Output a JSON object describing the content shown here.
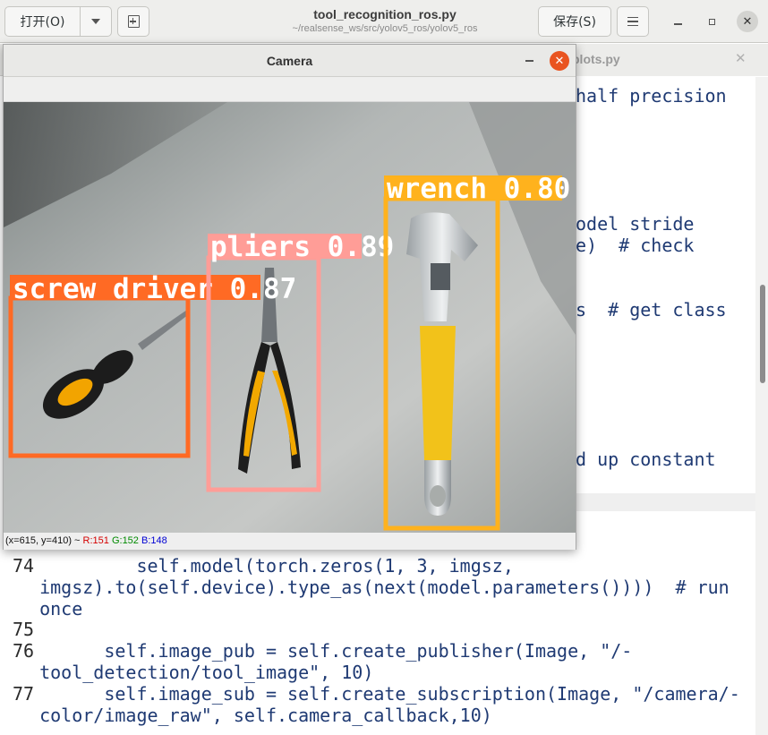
{
  "header": {
    "open_label": "打开(O)",
    "save_label": "保存(S)",
    "title": "tool_recognition_ros.py",
    "subtitle": "~/realsense_ws/src/yolov5_ros/yolov5_ros"
  },
  "tabs": [
    {
      "label": "plots.py"
    }
  ],
  "editor": {
    "top_fragments": [
      "half precision",
      "odel stride",
      "e)  # check",
      "s  # get class",
      "d up constant"
    ],
    "lines": [
      {
        "no": "74",
        "text": "           self.model(torch.zeros(1, 3, imgsz,"
      },
      {
        "no": "",
        "text": "  imgsz).to(self.device).type_as(next(model.parameters())))  # run"
      },
      {
        "no": "",
        "text": "  once"
      },
      {
        "no": "75",
        "text": ""
      },
      {
        "no": "76",
        "text": "        self.image_pub = self.create_publisher(Image, \"/-"
      },
      {
        "no": "",
        "text": "  tool_detection/tool_image\", 10)"
      },
      {
        "no": "77",
        "text": "        self.image_sub = self.create_subscription(Image, \"/camera/-"
      },
      {
        "no": "",
        "text": "  color/image_raw\", self.camera_callback,10)"
      }
    ]
  },
  "camera_window": {
    "title": "Camera",
    "detections": [
      {
        "label": "screw driver 0.87",
        "color": "#ff6a24"
      },
      {
        "label": "pliers 0.89",
        "color": "#ff9d97"
      },
      {
        "label": "wrench 0.80",
        "color": "#ffb21d"
      }
    ],
    "status": {
      "coords": "(x=615, y=410) ~ ",
      "r": "R:151",
      "g": "G:152",
      "b": "B:148"
    }
  }
}
